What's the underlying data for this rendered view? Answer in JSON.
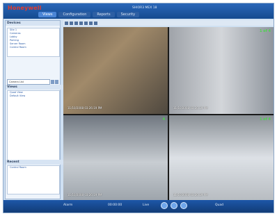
{
  "app": {
    "brand": "Honeywell",
    "window_title": "SHIOR3 MEX 18",
    "top_right_status": "",
    "top_right_secondary": ""
  },
  "tabs": [
    {
      "label": "Views"
    },
    {
      "label": "Configuration"
    },
    {
      "label": "Reports"
    },
    {
      "label": "Security"
    }
  ],
  "sidebar": {
    "tree_title": "Devices",
    "tree_items": [
      "Site 1",
      "Cameras",
      "Lobby",
      "Parking",
      "Server Room",
      "Control Room"
    ],
    "search": {
      "placeholder": "Camera List"
    },
    "views_title": "Views",
    "views_items": [
      "Quad View",
      "Default View"
    ],
    "recent_title": "Recent",
    "recent_items": [
      "Control Room"
    ]
  },
  "video": {
    "cells": [
      {
        "stamp": "11/10/2008 03:26:19 PM",
        "camid": ""
      },
      {
        "stamp": "11/10/2008 03:26:19 PM",
        "camid": "1 of 4"
      },
      {
        "stamp": "11/10/2008 03:26:19 PM",
        "camid": "4"
      },
      {
        "stamp": "11/10/2008 03:26:19 PM",
        "camid": "1 of 4"
      }
    ]
  },
  "bottom": {
    "left": "Alarm",
    "mid1": "00:00:00",
    "mid2": "Live",
    "right": "Quad"
  },
  "colors": {
    "brand": "#e53a2a",
    "topbar": "#1a58a3",
    "panel": "#eef4fb"
  }
}
